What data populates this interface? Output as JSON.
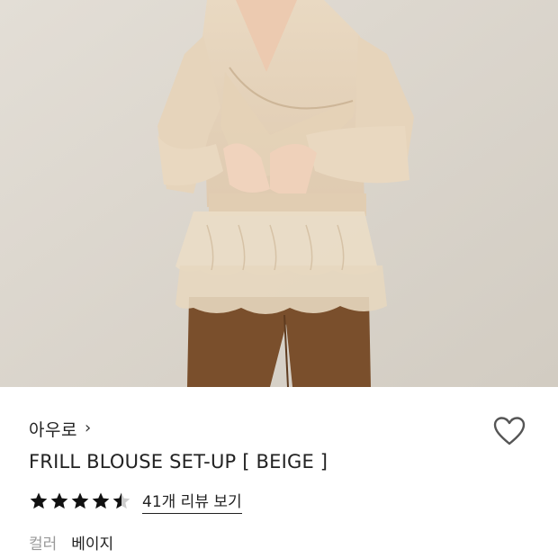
{
  "product": {
    "image_alt": "Model wearing a beige frill blouse with brown trousers",
    "brand": "아우로",
    "brand_chevron": "›",
    "title": "FRILL BLOUSE SET-UP [ BEIGE ]",
    "rating": 4.5,
    "rating_max": 5,
    "review_link": "41개 리뷰 보기",
    "option_label": "컬러",
    "option_value": "베이지"
  },
  "icons": {
    "wishlist": "heart-outline-icon",
    "star": "star-icon",
    "brand_arrow": "chevron-right-icon"
  },
  "colors": {
    "photo_background": "#dcd6cd",
    "blouse": "#e8d6bd",
    "pants": "#7a4f2c",
    "text": "#222222",
    "muted_text": "#999999",
    "star": "#111111",
    "star_empty": "#cccccc"
  }
}
